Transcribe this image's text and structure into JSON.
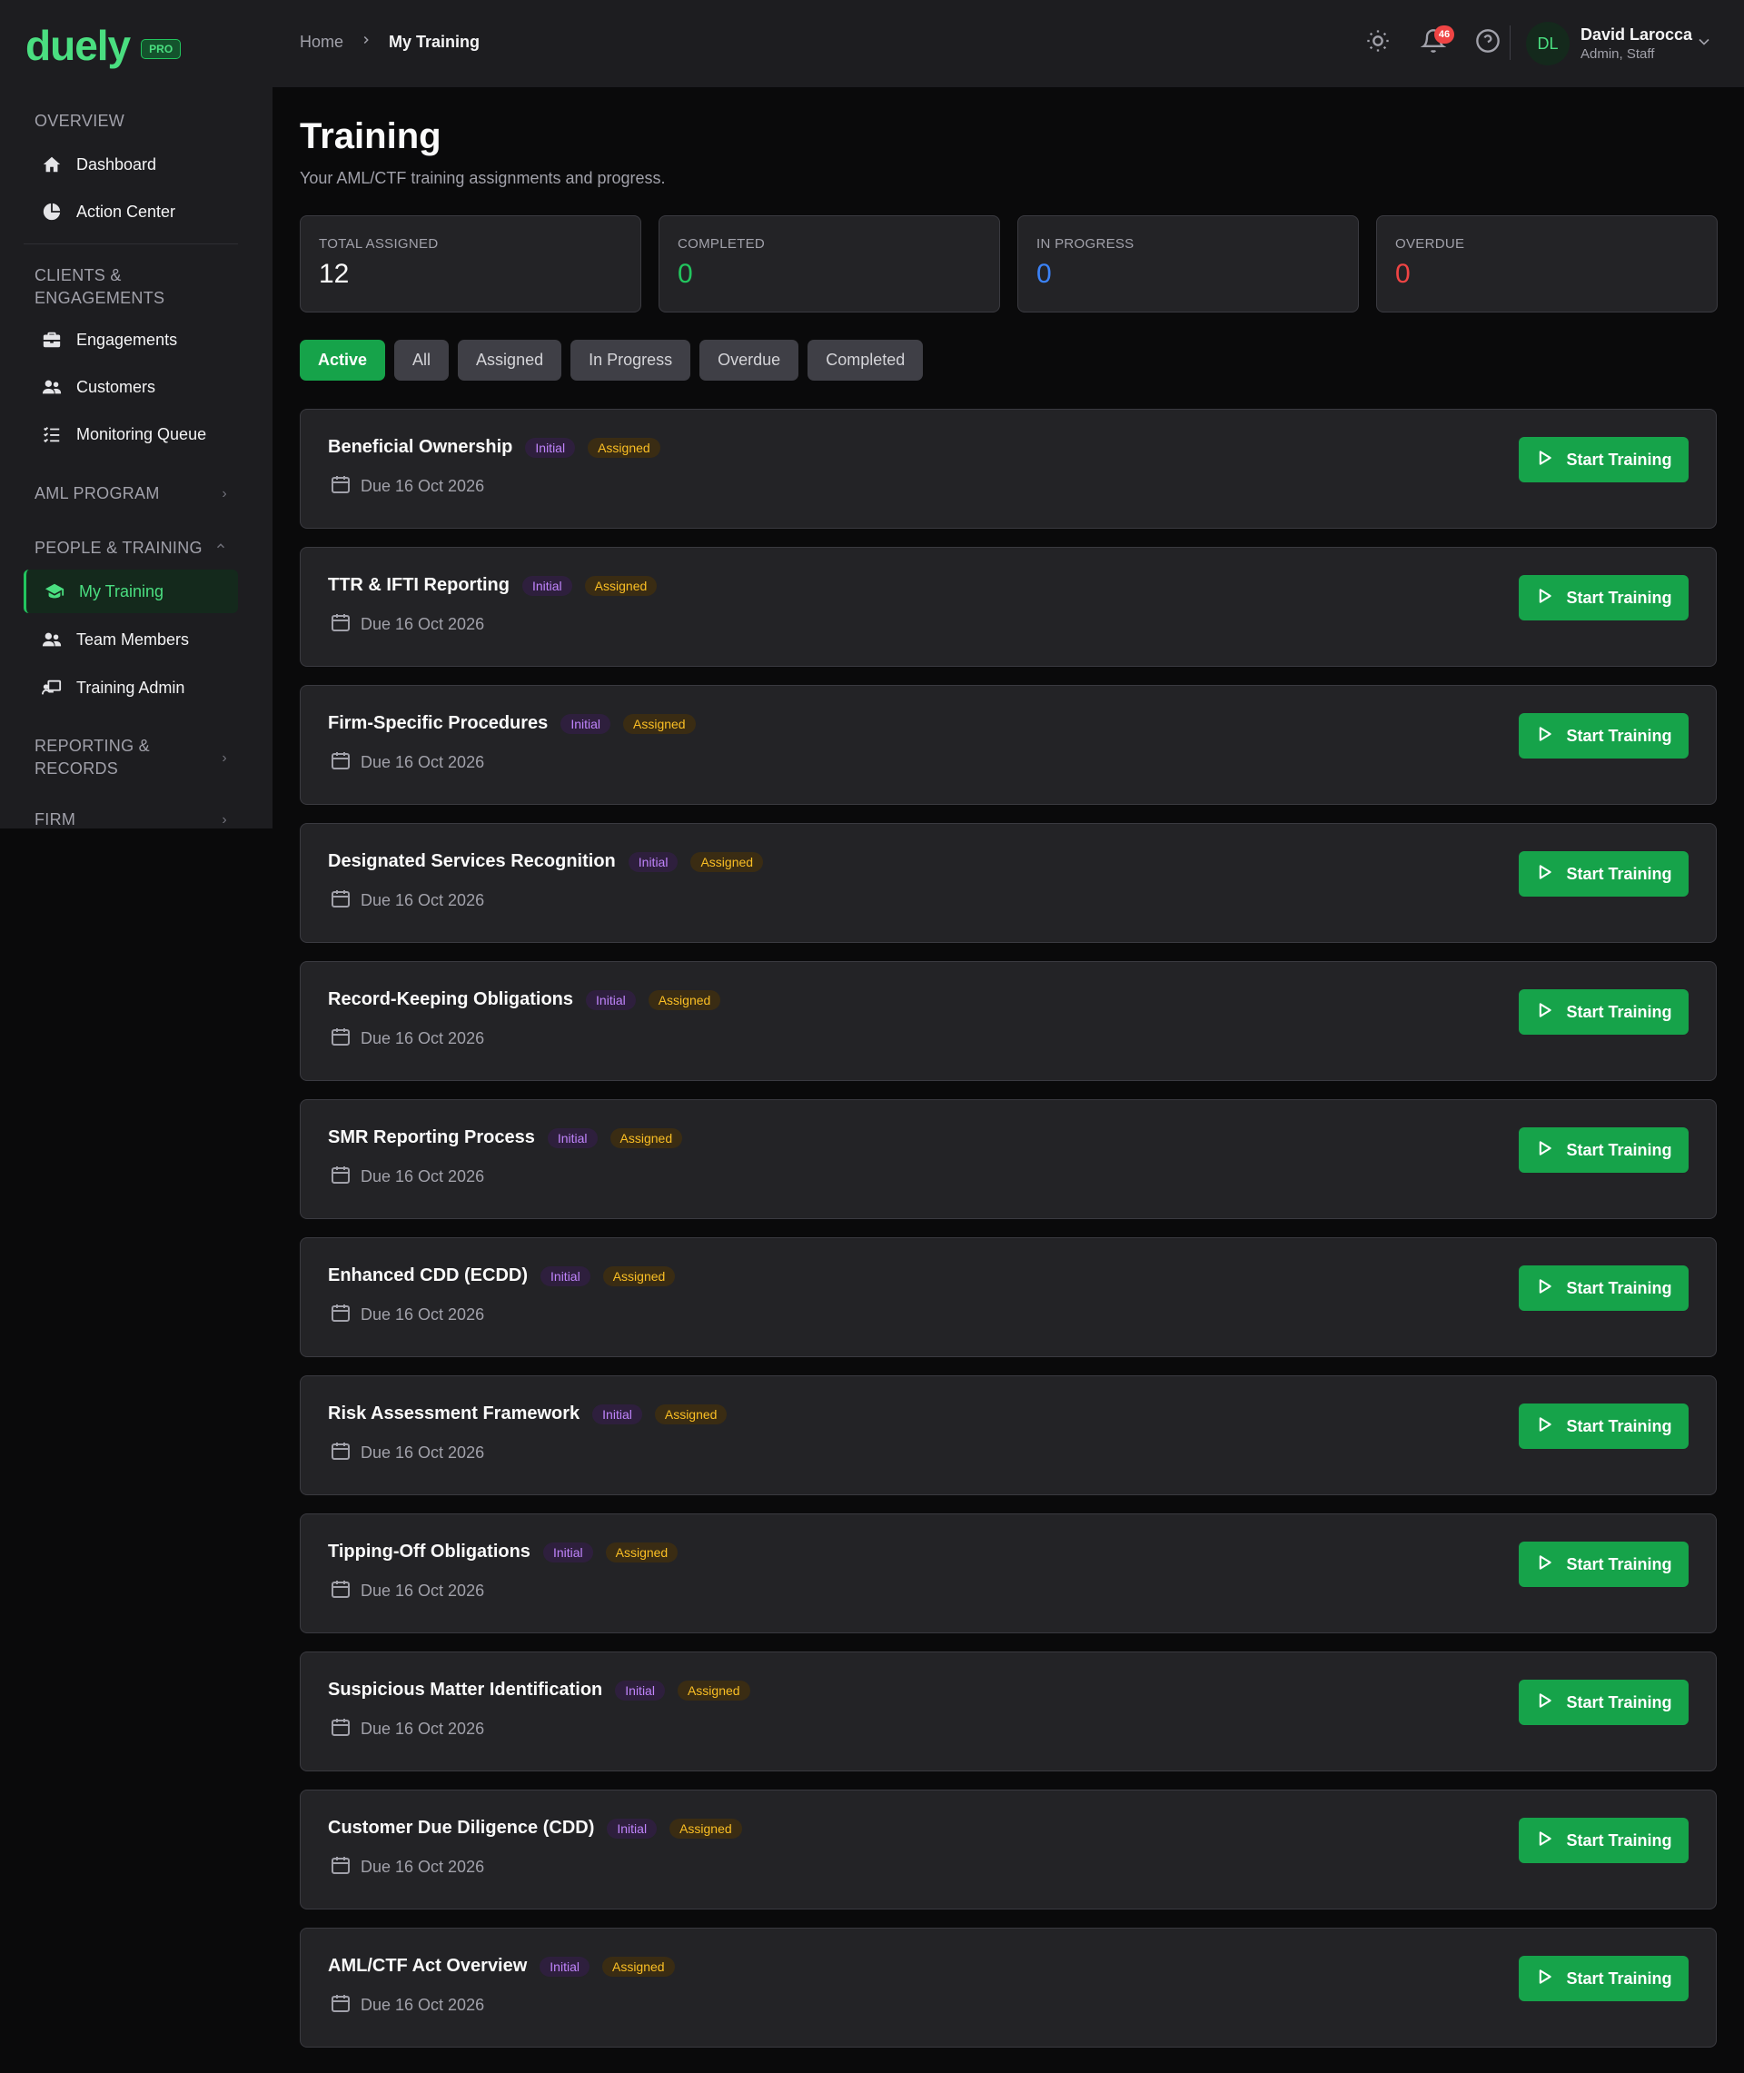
{
  "brand": {
    "name": "duely",
    "badge": "PRO"
  },
  "sidebar": {
    "sections": {
      "overview": "OVERVIEW",
      "clients_line1": "CLIENTS &",
      "clients_line2": "ENGAGEMENTS",
      "aml": "AML PROGRAM",
      "people": "PEOPLE & TRAINING",
      "reporting_line1": "REPORTING &",
      "reporting_line2": "RECORDS",
      "firm": "FIRM"
    },
    "items": {
      "dashboard": "Dashboard",
      "action_center": "Action Center",
      "engagements": "Engagements",
      "customers": "Customers",
      "monitoring_queue": "Monitoring Queue",
      "my_training": "My Training",
      "team_members": "Team Members",
      "training_admin": "Training Admin"
    }
  },
  "header": {
    "breadcrumb": {
      "home": "Home",
      "current": "My Training"
    },
    "notifications_count": "46",
    "user": {
      "initials": "DL",
      "name": "David Larocca",
      "role": "Admin, Staff"
    }
  },
  "page": {
    "title": "Training",
    "subtitle": "Your AML/CTF training assignments and progress."
  },
  "stats": [
    {
      "label": "TOTAL ASSIGNED",
      "value": "12",
      "color": "#fafafa"
    },
    {
      "label": "COMPLETED",
      "value": "0",
      "color": "#22c55e"
    },
    {
      "label": "IN PROGRESS",
      "value": "0",
      "color": "#3b82f6"
    },
    {
      "label": "OVERDUE",
      "value": "0",
      "color": "#ef4444"
    }
  ],
  "filters": [
    "Active",
    "All",
    "Assigned",
    "In Progress",
    "Overdue",
    "Completed"
  ],
  "trainings": [
    {
      "title": "Beneficial Ownership",
      "type": "Initial",
      "status": "Assigned",
      "due": "Due 16 Oct 2026",
      "action": "Start Training"
    },
    {
      "title": "TTR & IFTI Reporting",
      "type": "Initial",
      "status": "Assigned",
      "due": "Due 16 Oct 2026",
      "action": "Start Training"
    },
    {
      "title": "Firm-Specific Procedures",
      "type": "Initial",
      "status": "Assigned",
      "due": "Due 16 Oct 2026",
      "action": "Start Training"
    },
    {
      "title": "Designated Services Recognition",
      "type": "Initial",
      "status": "Assigned",
      "due": "Due 16 Oct 2026",
      "action": "Start Training"
    },
    {
      "title": "Record-Keeping Obligations",
      "type": "Initial",
      "status": "Assigned",
      "due": "Due 16 Oct 2026",
      "action": "Start Training"
    },
    {
      "title": "SMR Reporting Process",
      "type": "Initial",
      "status": "Assigned",
      "due": "Due 16 Oct 2026",
      "action": "Start Training"
    },
    {
      "title": "Enhanced CDD (ECDD)",
      "type": "Initial",
      "status": "Assigned",
      "due": "Due 16 Oct 2026",
      "action": "Start Training"
    },
    {
      "title": "Risk Assessment Framework",
      "type": "Initial",
      "status": "Assigned",
      "due": "Due 16 Oct 2026",
      "action": "Start Training"
    },
    {
      "title": "Tipping-Off Obligations",
      "type": "Initial",
      "status": "Assigned",
      "due": "Due 16 Oct 2026",
      "action": "Start Training"
    },
    {
      "title": "Suspicious Matter Identification",
      "type": "Initial",
      "status": "Assigned",
      "due": "Due 16 Oct 2026",
      "action": "Start Training"
    },
    {
      "title": "Customer Due Diligence (CDD)",
      "type": "Initial",
      "status": "Assigned",
      "due": "Due 16 Oct 2026",
      "action": "Start Training"
    },
    {
      "title": "AML/CTF Act Overview",
      "type": "Initial",
      "status": "Assigned",
      "due": "Due 16 Oct 2026",
      "action": "Start Training"
    }
  ]
}
